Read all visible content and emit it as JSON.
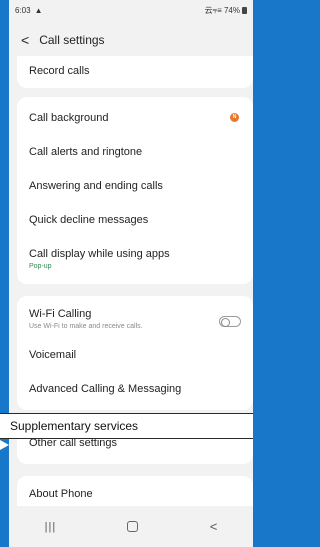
{
  "status_bar": {
    "time": "6:03",
    "left_icon": "warning-icon",
    "signal_text": "云⫧≡ 74%"
  },
  "header": {
    "back_icon": "<",
    "title": "Call settings"
  },
  "items": {
    "record_calls": "Record calls",
    "call_background": {
      "label": "Call background",
      "badge": "N"
    },
    "call_alerts": "Call alerts and ringtone",
    "answering_ending": "Answering and ending calls",
    "quick_decline": "Quick decline messages",
    "call_display": {
      "label": "Call display while using apps",
      "sub": "Pop-up"
    },
    "wifi_calling": {
      "label": "Wi-Fi Calling",
      "sub": "Use Wi-Fi to make and receive calls.",
      "enabled": false
    },
    "voicemail": "Voicemail",
    "advanced_calling": "Advanced Calling & Messaging",
    "other_call_settings": "Other call settings",
    "about_phone": "About Phone"
  },
  "tooltip": {
    "label": "Supplementary services"
  },
  "nav_bar": {
    "recent": "|||",
    "back": "<"
  },
  "colors": {
    "frame": "#1877c9",
    "badge": "#e8772e",
    "sub_green": "#2e8b57",
    "background": "#f2f2f2"
  }
}
